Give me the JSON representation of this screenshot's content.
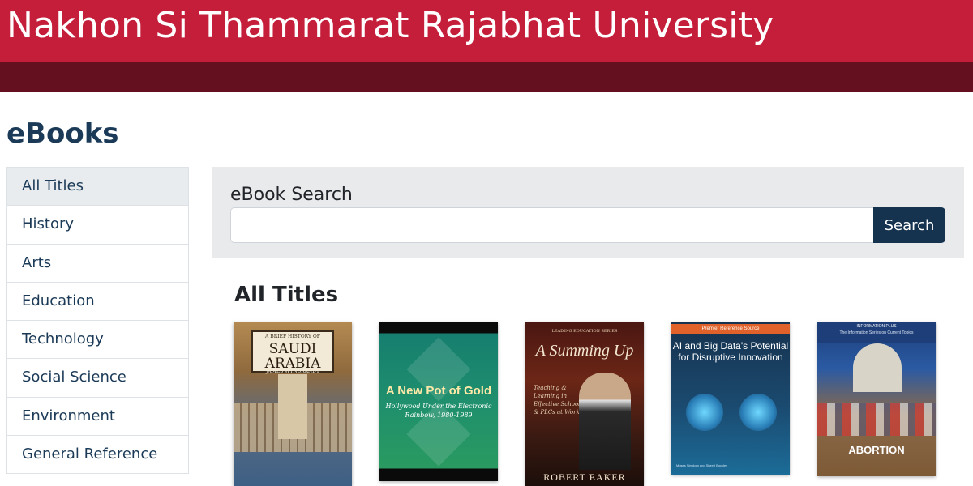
{
  "header": {
    "site_title": "Nakhon Si Thammarat Rajabhat University",
    "brand_color": "#c41e3a",
    "subbar_color": "#65101f"
  },
  "page": {
    "title": "eBooks"
  },
  "sidebar": {
    "items": [
      {
        "label": "All Titles",
        "active": true
      },
      {
        "label": "History"
      },
      {
        "label": "Arts"
      },
      {
        "label": "Education"
      },
      {
        "label": "Technology"
      },
      {
        "label": "Social Science"
      },
      {
        "label": "Environment"
      },
      {
        "label": "General Reference"
      }
    ]
  },
  "search": {
    "label": "eBook Search",
    "value": "",
    "button_label": "Search",
    "button_color": "#15334f"
  },
  "section": {
    "title": "All Titles"
  },
  "books": [
    {
      "series": "A BRIEF HISTORY OF",
      "title": "SAUDI ARABIA",
      "author": "JAMES WYNBRANDT"
    },
    {
      "title": "A New Pot of Gold",
      "subtitle": "Hollywood Under the Electronic Rainbow, 1980-1989"
    },
    {
      "series": "LEADING EDUCATION SERIES",
      "title": "A Summing Up",
      "subtitle": "Teaching & Learning in Effective Schools & PLCs at Work",
      "author": "ROBERT EAKER"
    },
    {
      "banner": "Premier Reference Source",
      "title": "AI and Big Data's Potential for Disruptive Innovation",
      "authors": "Moses Strydom and Sheryl Buckley"
    },
    {
      "series": "INFORMATION PLUS",
      "series_sub": "The Information Series on Current Topics",
      "title": "ABORTION"
    }
  ]
}
